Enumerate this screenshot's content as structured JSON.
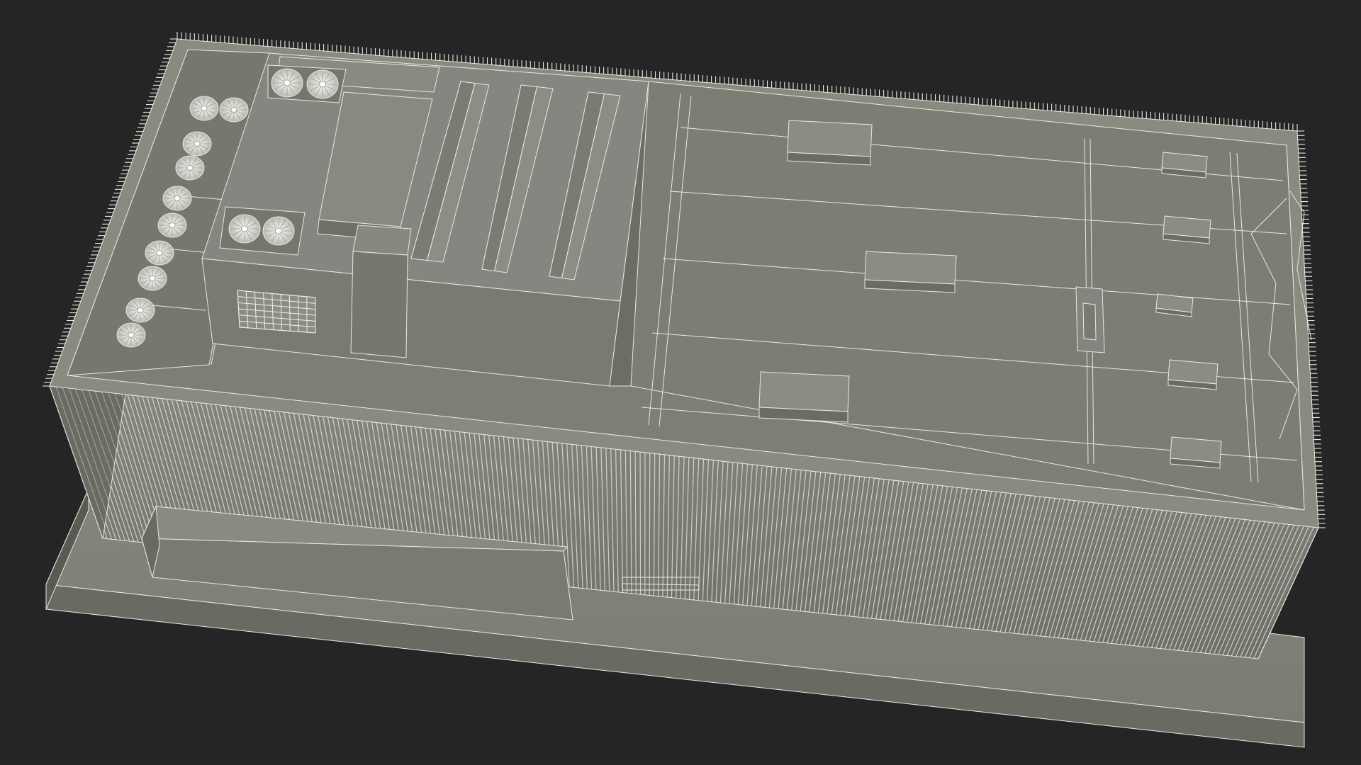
{
  "scene": {
    "subject": "building-wireframe-render",
    "render_style": "clay-with-wireframe",
    "colors": {
      "background": "#252525",
      "clay": "#7f7f76",
      "clay_light": "#8f8f86",
      "clay_dark": "#5e5e57",
      "clay_shadow": "#4a4a44",
      "wire": "#e8e8e0"
    },
    "fan_units": {
      "roof_pairs": 2,
      "left_bay_fans": 10
    },
    "skylights": 3,
    "roof_vents": 8
  }
}
